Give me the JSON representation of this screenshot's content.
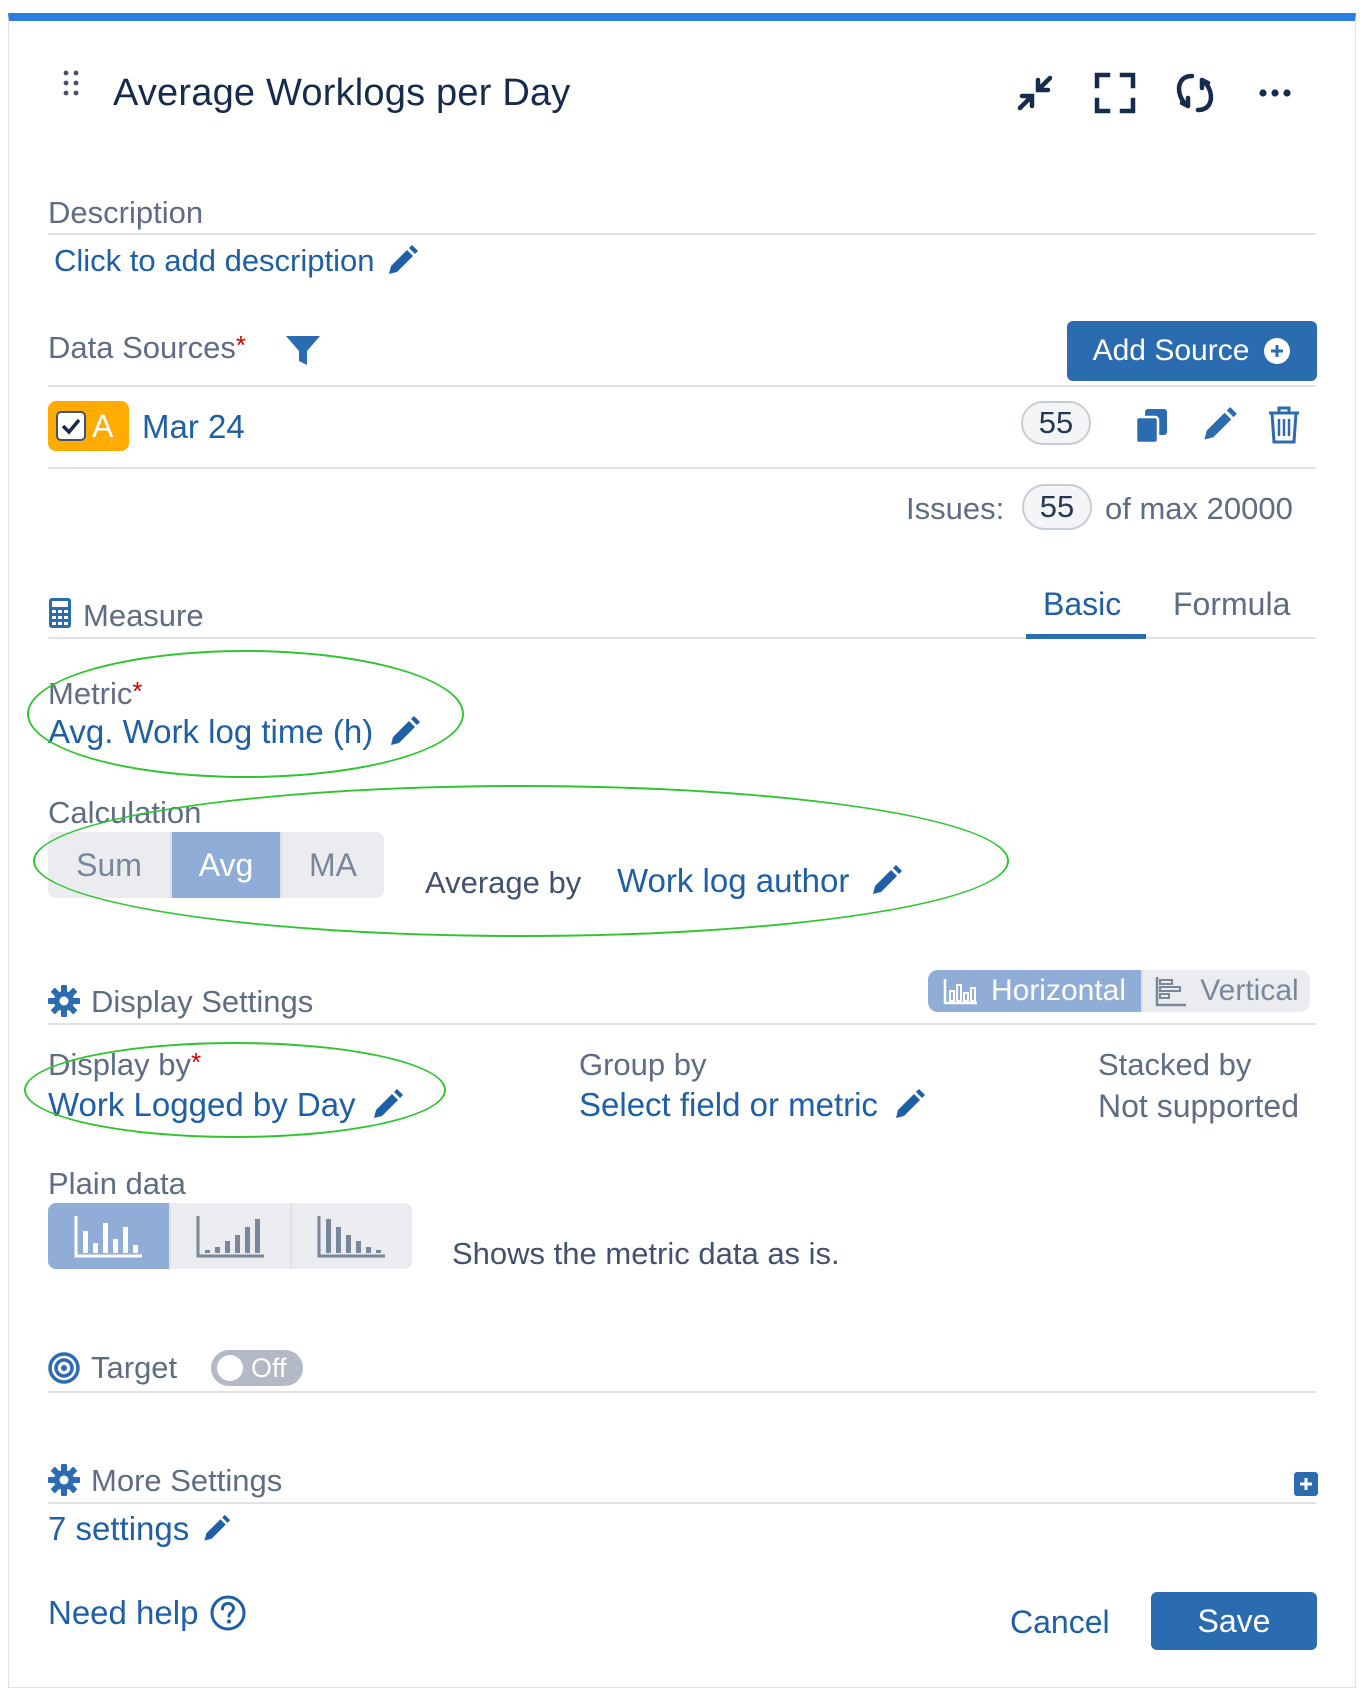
{
  "header": {
    "title": "Average Worklogs per Day"
  },
  "description": {
    "label": "Description",
    "add_link": "Click to add description"
  },
  "data_sources": {
    "label": "Data Sources",
    "required_mark": "*",
    "add_source_label": "Add Source",
    "source": {
      "letter": "A",
      "name": "Mar 24",
      "count": "55"
    }
  },
  "issues": {
    "label": "Issues:",
    "count": "55",
    "max_text": "of max 20000"
  },
  "measure": {
    "label": "Measure",
    "tabs": [
      {
        "label": "Basic",
        "active": true
      },
      {
        "label": "Formula",
        "active": false
      }
    ],
    "metric_label": "Metric",
    "metric_value": "Avg. Work log time (h)",
    "calculation_label": "Calculation",
    "calculation_options": [
      "Sum",
      "Avg",
      "MA"
    ],
    "calculation_selected": "Avg",
    "average_by_label": "Average by",
    "average_by_value": "Work log author"
  },
  "display_settings": {
    "label": "Display Settings",
    "orientation_options": [
      "Horizontal",
      "Vertical"
    ],
    "orientation_selected": "Horizontal",
    "display_by_label": "Display by",
    "display_by_value": "Work Logged by Day",
    "group_by_label": "Group by",
    "group_by_value": "Select field or metric",
    "stacked_by_label": "Stacked by",
    "stacked_by_value": "Not supported",
    "plain_data_label": "Plain data",
    "plain_data_description": "Shows the metric data as is."
  },
  "target": {
    "label": "Target",
    "toggle_label": "Off"
  },
  "more_settings": {
    "label": "More Settings",
    "settings_link": "7 settings"
  },
  "footer": {
    "help_label": "Need help",
    "cancel_label": "Cancel",
    "save_label": "Save"
  },
  "colors": {
    "accent": "#2b6cb0",
    "link": "#1e5fa6",
    "top_bar": "#2f7de1",
    "source_badge": "#ffab00",
    "highlight_ellipse": "#2ec52e",
    "required": "#d00000"
  }
}
